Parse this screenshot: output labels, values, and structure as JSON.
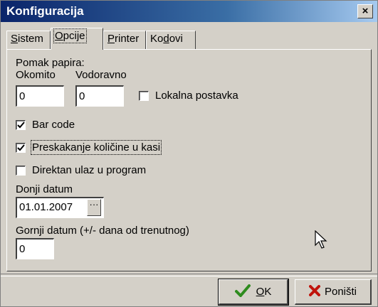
{
  "window": {
    "title": "Konfiguracija",
    "close_glyph": "×"
  },
  "tabs": [
    {
      "pre": "",
      "u": "S",
      "post": "istem"
    },
    {
      "pre": "",
      "u": "O",
      "post": "pcije"
    },
    {
      "pre": "",
      "u": "P",
      "post": "rinter"
    },
    {
      "pre": "Ko",
      "u": "d",
      "post": "ovi"
    }
  ],
  "form": {
    "paper_offset_label": "Pomak papira:",
    "vertical_label": "Okomito",
    "horizontal_label": "Vodoravno",
    "vertical_value": "0",
    "horizontal_value": "0",
    "local_setting_label": "Lokalna postavka",
    "local_setting_checked": false,
    "barcode_label": "Bar code",
    "barcode_checked": true,
    "skip_quantity_label": "Preskakanje količine u kasi",
    "skip_quantity_checked": true,
    "direct_entry_label": "Direktan ulaz u program",
    "direct_entry_checked": false,
    "lower_date_label": "Donji datum",
    "lower_date_value": "01.01.2007",
    "ellipsis_label": "···",
    "upper_date_label": "Gornji datum (+/- dana od trenutnog)",
    "upper_date_value": "0"
  },
  "buttons": {
    "ok_u": "O",
    "ok_rest": "K",
    "cancel_label": "Poništi"
  },
  "icons": {
    "ok": "check-icon",
    "cancel": "x-icon",
    "ok_color": "#2e8b1e",
    "cancel_color": "#c0140c"
  }
}
